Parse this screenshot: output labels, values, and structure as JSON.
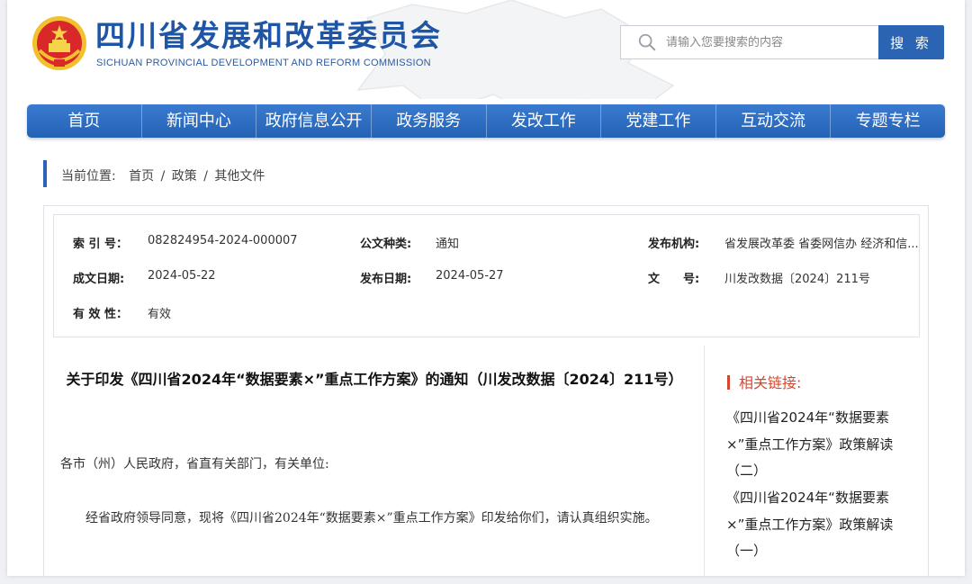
{
  "site": {
    "title": "四川省发展和改革委员会",
    "subtitle": "SICHUAN PROVINCIAL DEVELOPMENT AND REFORM COMMISSION",
    "logo_icon": "emblem-icon",
    "brand_color": "#1f55a5"
  },
  "search": {
    "placeholder": "请输入您要搜索的内容",
    "value": "",
    "button_label": "搜 索"
  },
  "nav": {
    "items": [
      {
        "label": "首页"
      },
      {
        "label": "新闻中心"
      },
      {
        "label": "政府信息公开"
      },
      {
        "label": "政务服务"
      },
      {
        "label": "发改工作"
      },
      {
        "label": "党建工作"
      },
      {
        "label": "互动交流"
      },
      {
        "label": "专题专栏"
      }
    ]
  },
  "breadcrumb": {
    "prefix": "当前位置:",
    "items": [
      "首页",
      "政策",
      "其他文件"
    ],
    "separator": "/"
  },
  "meta": {
    "index_label": "索 引 号：",
    "index_value": "082824954-2024-000007",
    "doctype_label": "公文种类:",
    "doctype_value": "通知",
    "issuer_label": "发布机构:",
    "issuer_value": "省发展改革委 省委网信办 经济和信...",
    "created_label": "成文日期:",
    "created_value": "2024-05-22",
    "published_label": "发布日期:",
    "published_value": "2024-05-27",
    "docno_label": "文　　号:",
    "docno_value": "川发改数据〔2024〕211号",
    "validity_label": "有 效 性：",
    "validity_value": "有效"
  },
  "article": {
    "title": "关于印发《四川省2024年“数据要素×”重点工作方案》的通知（川发改数据〔2024〕211号）",
    "salutation": "各市（州）人民政府，省直有关部门，有关单位:",
    "paragraph": "经省政府领导同意，现将《四川省2024年“数据要素×”重点工作方案》印发给你们，请认真组织实施。"
  },
  "related": {
    "heading": "相关链接:",
    "accent_color": "#d4472f",
    "links": [
      {
        "label": "《四川省2024年“数据要素×”重点工作方案》政策解读（二）"
      },
      {
        "label": "《四川省2024年“数据要素×”重点工作方案》政策解读（一）"
      }
    ]
  }
}
